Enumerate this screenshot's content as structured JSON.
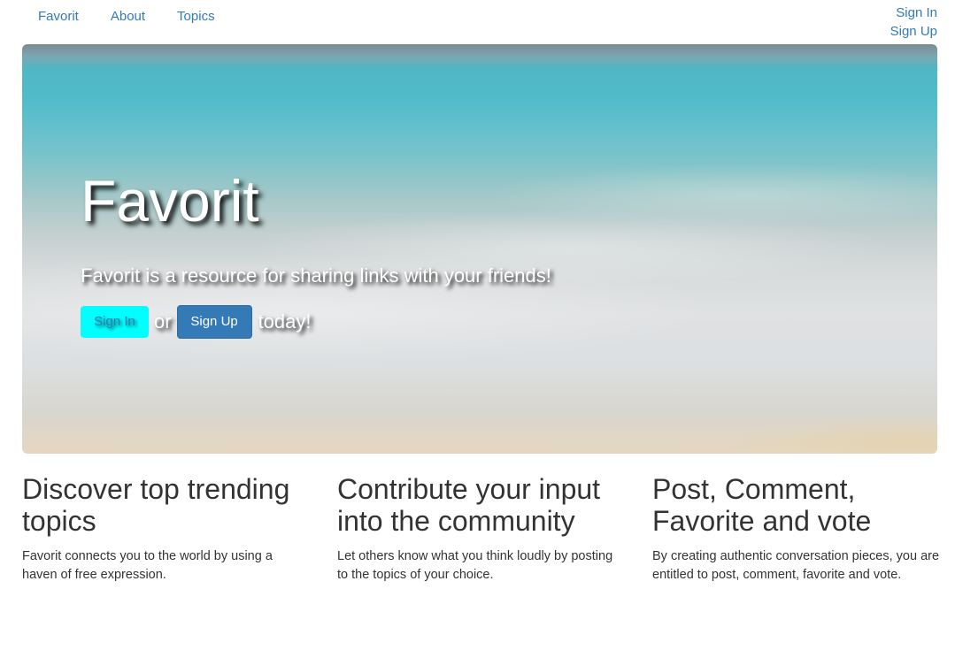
{
  "nav": {
    "brand": "Favorit",
    "links": [
      "About",
      "Topics"
    ],
    "sign_in": "Sign In",
    "sign_up": "Sign Up"
  },
  "hero": {
    "title": "Favorit",
    "lead": "Favorit is a resource for sharing links with your friends!",
    "signin_button": "Sign In",
    "or_text": "or",
    "signup_button": "Sign Up",
    "today_text": "today!"
  },
  "features": [
    {
      "heading": "Discover top trending topics",
      "text": "Favorit connects you to the world by using a haven of free expression."
    },
    {
      "heading": "Contribute your input into the community",
      "text": "Let others know what you think loudly by posting to the topics of your choice."
    },
    {
      "heading": "Post, Comment, Favorite and vote",
      "text": "By creating authentic conversation pieces, you are entitled to post, comment, favorite and vote."
    }
  ],
  "colors": {
    "link": "#337ab7",
    "signin_button_bg": "#00ffff",
    "signup_button_bg": "#337ab7"
  }
}
